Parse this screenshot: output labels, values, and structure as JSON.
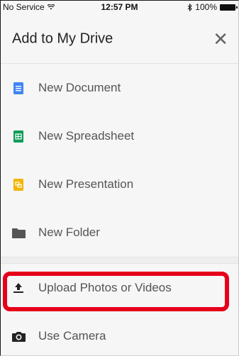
{
  "status": {
    "carrier": "No Service",
    "time": "12:57 PM",
    "battery": "100%"
  },
  "header": {
    "title": "Add to My Drive",
    "close_glyph": "✕"
  },
  "menu": {
    "items": [
      {
        "label": "New Document",
        "icon": "docs-icon",
        "color": "#4285f4"
      },
      {
        "label": "New Spreadsheet",
        "icon": "sheets-icon",
        "color": "#0f9d58"
      },
      {
        "label": "New Presentation",
        "icon": "slides-icon",
        "color": "#f4b400"
      },
      {
        "label": "New Folder",
        "icon": "folder-icon",
        "color": "#5f6368"
      },
      {
        "label": "Upload Photos or Videos",
        "icon": "upload-icon",
        "color": "#222222"
      },
      {
        "label": "Use Camera",
        "icon": "camera-icon",
        "color": "#222222"
      }
    ]
  },
  "highlight": {
    "color": "#e6001a",
    "target": "Upload Photos or Videos"
  }
}
